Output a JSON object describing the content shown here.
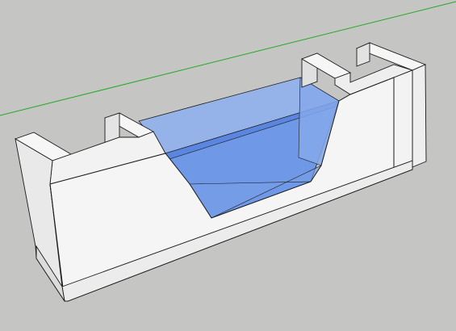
{
  "viewport": {
    "background": "#c5c5c3",
    "axis_color": "#22aa22"
  },
  "model": {
    "wall_face": "#f4f4f4",
    "wall_side": "#e6e6e6",
    "wall_dark": "#d8d8d8",
    "edge": "#1a1a1a",
    "glass_light": "#8fb0ec",
    "glass_mid": "#6f98e6",
    "glass_dark": "#5a86df"
  }
}
